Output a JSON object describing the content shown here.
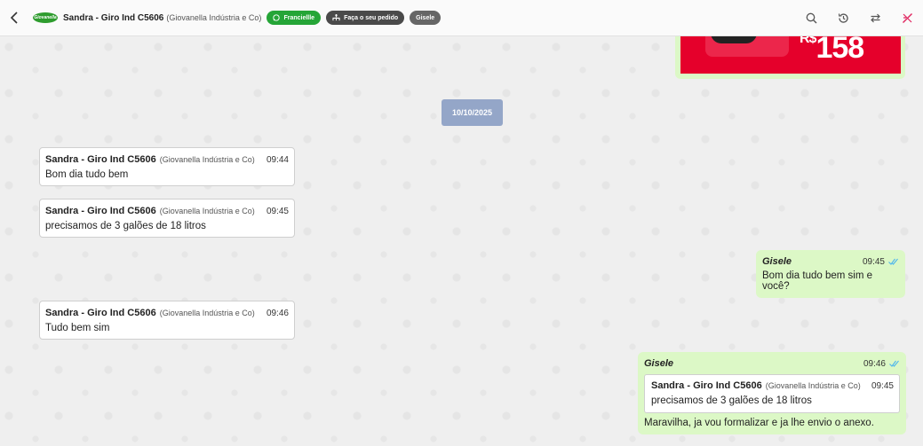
{
  "header": {
    "contact_name": "Sandra - Giro Ind C5606",
    "contact_company": "(Giovanella Indústria e Co)",
    "logo_text": "Giovanella",
    "tag_agent": "Franciellle",
    "tag_order": "Faça o seu pedido",
    "tag_user": "Gisele"
  },
  "media": {
    "price_prefix": "R$",
    "price": "158"
  },
  "date_divider": "10/10/2025",
  "incoming": [
    {
      "name": "Sandra - Giro Ind C5606",
      "company": "(Giovanella Indústria e Co)",
      "time": "09:44",
      "text": "Bom dia tudo bem"
    },
    {
      "name": "Sandra - Giro Ind C5606",
      "company": "(Giovanella Indústria e Co)",
      "time": "09:45",
      "text": "precisamos de 3 galões de 18 litros"
    },
    {
      "name": "Sandra - Giro Ind C5606",
      "company": "(Giovanella Indústria e Co)",
      "time": "09:46",
      "text": "Tudo bem sim"
    }
  ],
  "outgoing": [
    {
      "name": "Gisele",
      "time": "09:45",
      "text": "Bom dia tudo bem sim e você?"
    },
    {
      "name": "Gisele",
      "time": "09:46",
      "quote": {
        "name": "Sandra - Giro Ind C5606",
        "company": "(Giovanella Indústria e Co)",
        "time": "09:45",
        "text": "precisamos de 3 galões de 18 litros"
      },
      "text": "Maravilha, ja vou formalizar e ja lhe envio o anexo."
    }
  ],
  "colors": {
    "outgoing_bubble": "#dcf8c6",
    "date_chip": "#94a6c8",
    "whatsapp_green": "#25a537",
    "read_ticks": "#4fb6ec",
    "alert_icon": "#e0245e"
  },
  "icons": [
    "chevron-left-icon",
    "whatsapp-icon",
    "order-icon",
    "search-icon",
    "history-icon",
    "transfer-icon",
    "close-ticket-icon",
    "double-check-icon"
  ]
}
